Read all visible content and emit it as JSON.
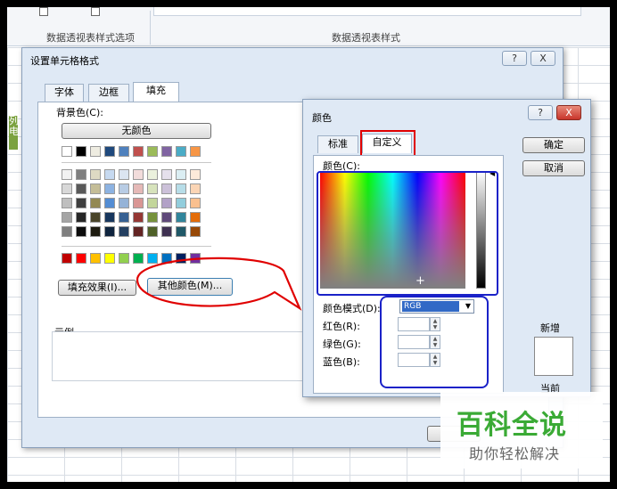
{
  "ribbon": {
    "top_text_left": "...",
    "section_left": "数据透视表样式选项",
    "section_right": "数据透视表样式"
  },
  "sheet": {
    "left_cells": [
      "列",
      "电"
    ]
  },
  "format_dialog": {
    "title": "设置单元格格式",
    "help_btn": "?",
    "close_btn": "X",
    "tabs": [
      "字体",
      "边框",
      "填充"
    ],
    "active_tab": "填充",
    "background_color_label": "背景色(C):",
    "no_color_btn": "无颜色",
    "fill_effects_btn": "填充效果(I)...",
    "more_colors_btn": "其他颜色(M)...",
    "sample_label": "示例",
    "theme_colors_top": [
      "#ffffff",
      "#000000",
      "#eeece1",
      "#1f497d",
      "#4f81bd",
      "#c0504d",
      "#9bbb59",
      "#8064a2",
      "#4bacc6",
      "#f79646"
    ],
    "theme_tints": [
      [
        "#f2f2f2",
        "#7f7f7f",
        "#ddd9c3",
        "#c6d9f0",
        "#dbe5f1",
        "#f2dcdb",
        "#ebf1dd",
        "#e5e0ec",
        "#dbeef3",
        "#fdeada"
      ],
      [
        "#d8d8d8",
        "#595959",
        "#c4bd97",
        "#8db3e2",
        "#b8cce4",
        "#e5b9b7",
        "#d7e3bc",
        "#ccc1d9",
        "#b7dde8",
        "#fbd5b5"
      ],
      [
        "#bfbfbf",
        "#3f3f3f",
        "#938953",
        "#548dd4",
        "#95b3d7",
        "#d99694",
        "#c3d69b",
        "#b2a2c7",
        "#92cddc",
        "#fac08f"
      ],
      [
        "#a5a5a5",
        "#262626",
        "#494429",
        "#17365d",
        "#366092",
        "#953734",
        "#76923c",
        "#5f497a",
        "#31859b",
        "#e36c09"
      ],
      [
        "#7f7f7f",
        "#0c0c0c",
        "#1d1b10",
        "#0f243e",
        "#244061",
        "#632423",
        "#4f6128",
        "#3f3151",
        "#205867",
        "#974806"
      ]
    ],
    "standard_colors": [
      "#c00000",
      "#ff0000",
      "#ffc000",
      "#ffff00",
      "#92d050",
      "#00b050",
      "#00b0f0",
      "#0070c0",
      "#002060",
      "#7030a0"
    ]
  },
  "color_dialog": {
    "title": "颜色",
    "help_btn": "?",
    "close_btn": "X",
    "tabs": [
      "标准",
      "自定义"
    ],
    "active_tab": "自定义",
    "colors_label": "颜色(C):",
    "ok_btn": "确定",
    "cancel_btn": "取消",
    "color_model_label": "颜色模式(D):",
    "color_model_value": "RGB",
    "red_label": "红色(R):",
    "green_label": "绿色(G):",
    "blue_label": "蓝色(B):",
    "red_value": "",
    "green_value": "",
    "blue_value": "",
    "new_label": "新增",
    "current_label": "当前"
  },
  "watermark": {
    "title": "百科全说",
    "subtitle": "助你轻松解决"
  },
  "colors": {
    "annotation_red": "#e00000",
    "annotation_blue": "#1a22c8",
    "watermark_green": "#3aaa35"
  }
}
